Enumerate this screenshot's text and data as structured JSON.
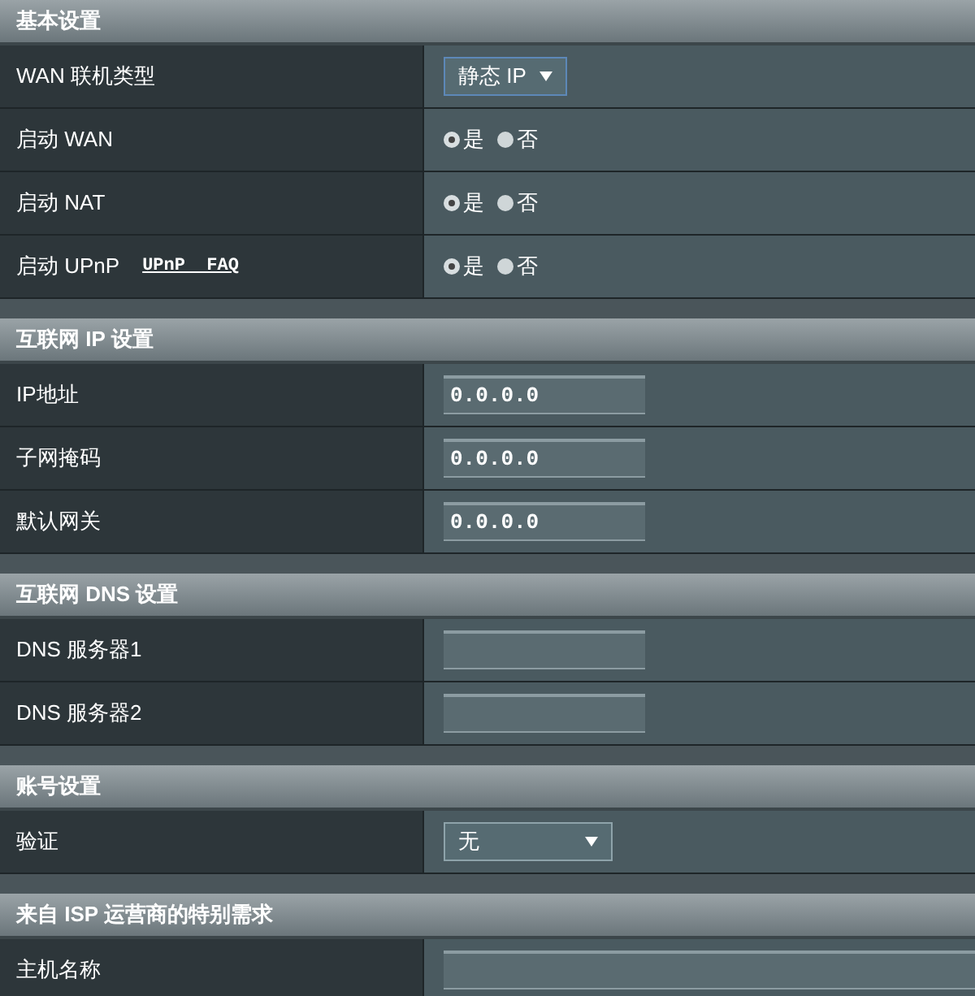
{
  "sections": [
    {
      "title": "基本设置",
      "rows": [
        {
          "label": "WAN 联机类型",
          "kind": "select",
          "value": "静态 IP"
        },
        {
          "label": "启动 WAN",
          "kind": "radio",
          "options": [
            {
              "label": "是",
              "selected": true
            },
            {
              "label": "否",
              "selected": false
            }
          ]
        },
        {
          "label": "启动 NAT",
          "kind": "radio",
          "options": [
            {
              "label": "是",
              "selected": true
            },
            {
              "label": "否",
              "selected": false
            }
          ]
        },
        {
          "label": "启动 UPnP",
          "link": "UPnP  FAQ",
          "kind": "radio",
          "options": [
            {
              "label": "是",
              "selected": true
            },
            {
              "label": "否",
              "selected": false
            }
          ]
        }
      ]
    },
    {
      "title": "互联网 IP 设置",
      "rows": [
        {
          "label": "IP地址",
          "kind": "input",
          "value": "0.0.0.0"
        },
        {
          "label": "子网掩码",
          "kind": "input",
          "value": "0.0.0.0"
        },
        {
          "label": "默认网关",
          "kind": "input",
          "value": "0.0.0.0"
        }
      ]
    },
    {
      "title": "互联网 DNS 设置",
      "rows": [
        {
          "label": "DNS 服务器1",
          "kind": "input"
        },
        {
          "label": "DNS 服务器2",
          "kind": "input"
        }
      ]
    },
    {
      "title": "账号设置",
      "rows": [
        {
          "label": "验证",
          "kind": "select",
          "value": "无"
        }
      ]
    },
    {
      "title": "来自 ISP 运营商的特别需求",
      "rows": [
        {
          "label": "主机名称",
          "kind": "wide-input"
        }
      ]
    }
  ]
}
